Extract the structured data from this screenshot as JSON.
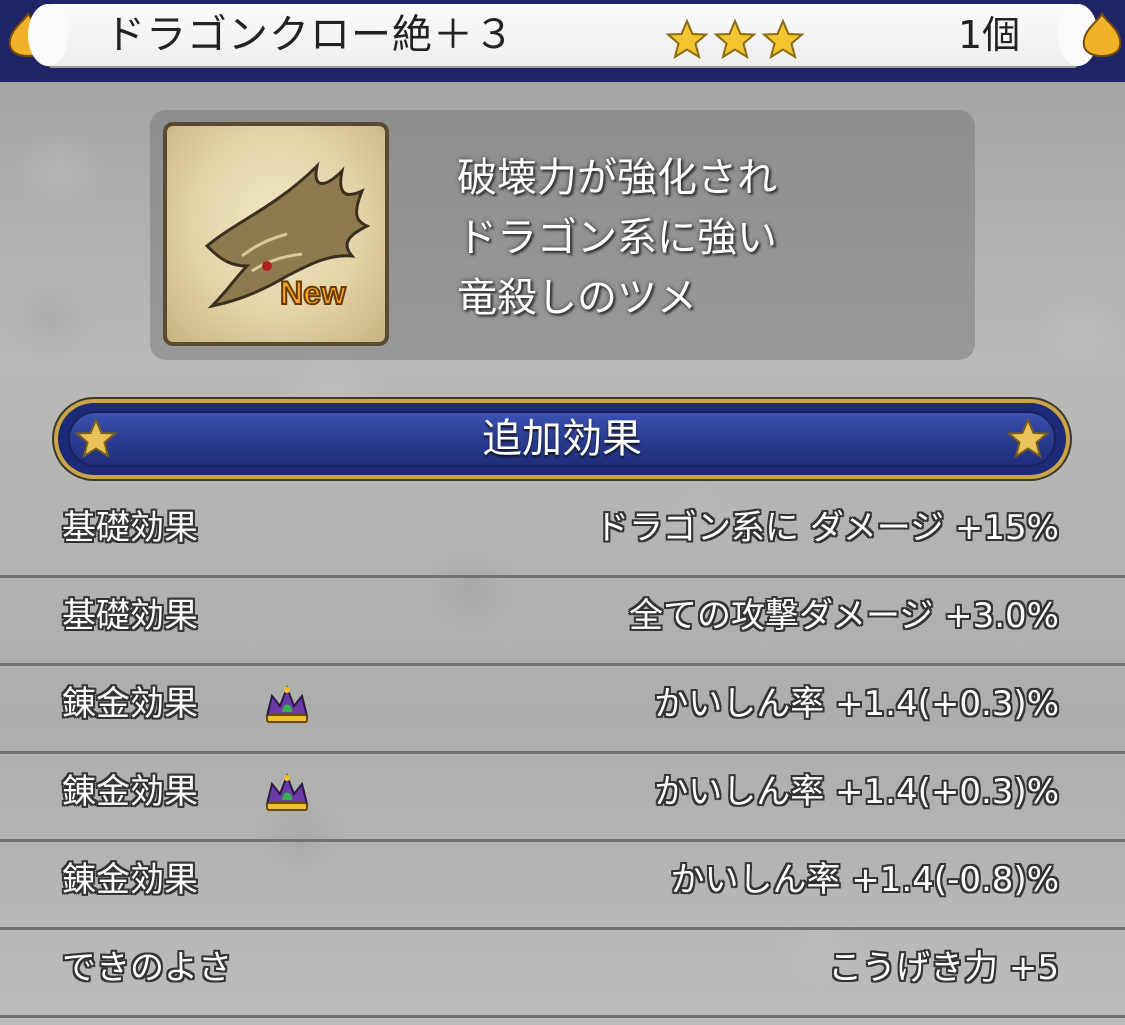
{
  "header": {
    "item_name": "ドラゴンクロー絶＋３",
    "star_count": 3,
    "quantity": "1個",
    "star_color": "#f3c531"
  },
  "item": {
    "icon": "dragon-claw-icon",
    "new_badge": "New",
    "description": [
      "破壊力が強化され",
      "ドラゴン系に強い",
      "竜殺しのツメ"
    ]
  },
  "section": {
    "title": "追加効果"
  },
  "effects": [
    {
      "label": "基礎効果",
      "value": "ドラゴン系に ダメージ +15%",
      "crown": false
    },
    {
      "label": "基礎効果",
      "value": "全ての攻撃ダメージ +3.0%",
      "crown": false
    },
    {
      "label": "錬金効果",
      "value": "かいしん率 +1.4(+0.3)%",
      "crown": true
    },
    {
      "label": "錬金効果",
      "value": "かいしん率 +1.4(+0.3)%",
      "crown": true
    },
    {
      "label": "錬金効果",
      "value": "かいしん率 +1.4(-0.8)%",
      "crown": false
    },
    {
      "label": "できのよさ",
      "value": "こうげき力 +5",
      "crown": false
    }
  ],
  "colors": {
    "header_bg": "#1d2566",
    "banner_bg": "#2d3f95",
    "banner_border": "#caa449"
  }
}
